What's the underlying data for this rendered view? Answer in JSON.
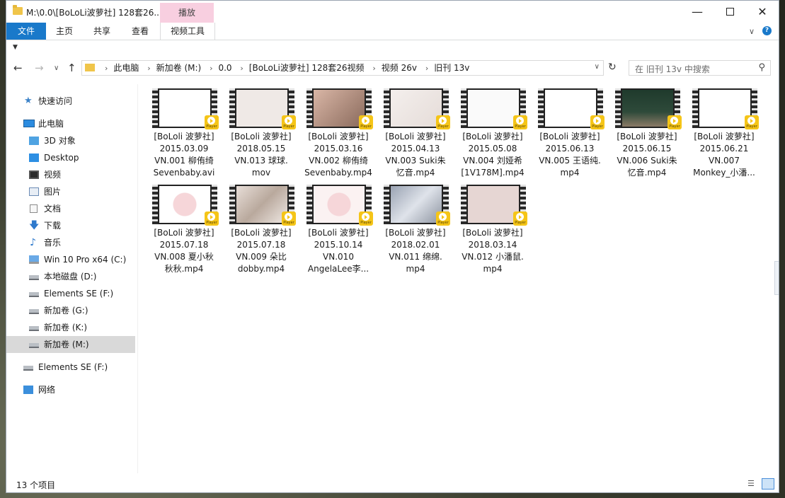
{
  "window": {
    "title": "M:\\0.0\\[BoLoLi波萝社] 128套26...",
    "context_tab": "播放"
  },
  "ribbon": {
    "tabs": [
      "文件",
      "主页",
      "共享",
      "查看",
      "视频工具"
    ]
  },
  "address": {
    "crumbs": [
      "此电脑",
      "新加卷 (M:)",
      "0.0",
      "[BoLoLi波萝社] 128套26视频",
      "视频 26v",
      "旧刊 13v"
    ]
  },
  "search": {
    "placeholder": "在 旧刊 13v 中搜索"
  },
  "sidebar": {
    "items": [
      {
        "label": "快速访问"
      },
      {
        "label": "此电脑"
      },
      {
        "label": "3D 对象"
      },
      {
        "label": "Desktop"
      },
      {
        "label": "视频"
      },
      {
        "label": "图片"
      },
      {
        "label": "文档"
      },
      {
        "label": "下载"
      },
      {
        "label": "音乐"
      },
      {
        "label": "Win 10 Pro x64 (C:)"
      },
      {
        "label": "本地磁盘 (D:)"
      },
      {
        "label": "Elements SE (F:)"
      },
      {
        "label": "新加卷 (G:)"
      },
      {
        "label": "新加卷 (K:)"
      },
      {
        "label": "新加卷 (M:)"
      },
      {
        "label": "Elements SE (F:)"
      },
      {
        "label": "网络"
      }
    ]
  },
  "files": {
    "badge_label": "Player",
    "items": [
      {
        "line1": "[BoLoli 波萝社]",
        "line2": "2015.03.09",
        "line3": "VN.001 柳侑绮",
        "line4": "Sevenbaby.avi"
      },
      {
        "line1": "[BoLoli 波萝社]",
        "line2": "2018.05.15",
        "line3": "VN.013 球球.",
        "line4": "mov"
      },
      {
        "line1": "[BoLoli 波萝社]",
        "line2": "2015.03.16",
        "line3": "VN.002 柳侑绮",
        "line4": "Sevenbaby.mp4"
      },
      {
        "line1": "[BoLoli 波萝社]",
        "line2": "2015.04.13",
        "line3": "VN.003 Suki朱",
        "line4": "忆音.mp4"
      },
      {
        "line1": "[BoLoli 波萝社]",
        "line2": "2015.05.08",
        "line3": "VN.004 刘娅希",
        "line4": "[1V178M].mp4"
      },
      {
        "line1": "[BoLoli 波萝社]",
        "line2": "2015.06.13",
        "line3": "VN.005 王语纯.",
        "line4": "mp4"
      },
      {
        "line1": "[BoLoli 波萝社]",
        "line2": "2015.06.15",
        "line3": "VN.006 Suki朱",
        "line4": "忆音.mp4"
      },
      {
        "line1": "[BoLoli 波萝社]",
        "line2": "2015.06.21",
        "line3": "VN.007",
        "line4": "Monkey_小潘..."
      },
      {
        "line1": "[BoLoli 波萝社]",
        "line2": "2015.07.18",
        "line3": "VN.008 夏小秋",
        "line4": "秋秋.mp4"
      },
      {
        "line1": "[BoLoli 波萝社]",
        "line2": "2015.07.18",
        "line3": "VN.009 朵比",
        "line4": "dobby.mp4"
      },
      {
        "line1": "[BoLoli 波萝社]",
        "line2": "2015.10.14",
        "line3": "VN.010",
        "line4": "AngelaLee李..."
      },
      {
        "line1": "[BoLoli 波萝社]",
        "line2": "2018.02.01",
        "line3": "VN.011 绵绵.",
        "line4": "mp4"
      },
      {
        "line1": "[BoLoli 波萝社]",
        "line2": "2018.03.14",
        "line3": "VN.012 小潘鼠.",
        "line4": "mp4"
      }
    ]
  },
  "status": {
    "count": "13 个项目"
  }
}
